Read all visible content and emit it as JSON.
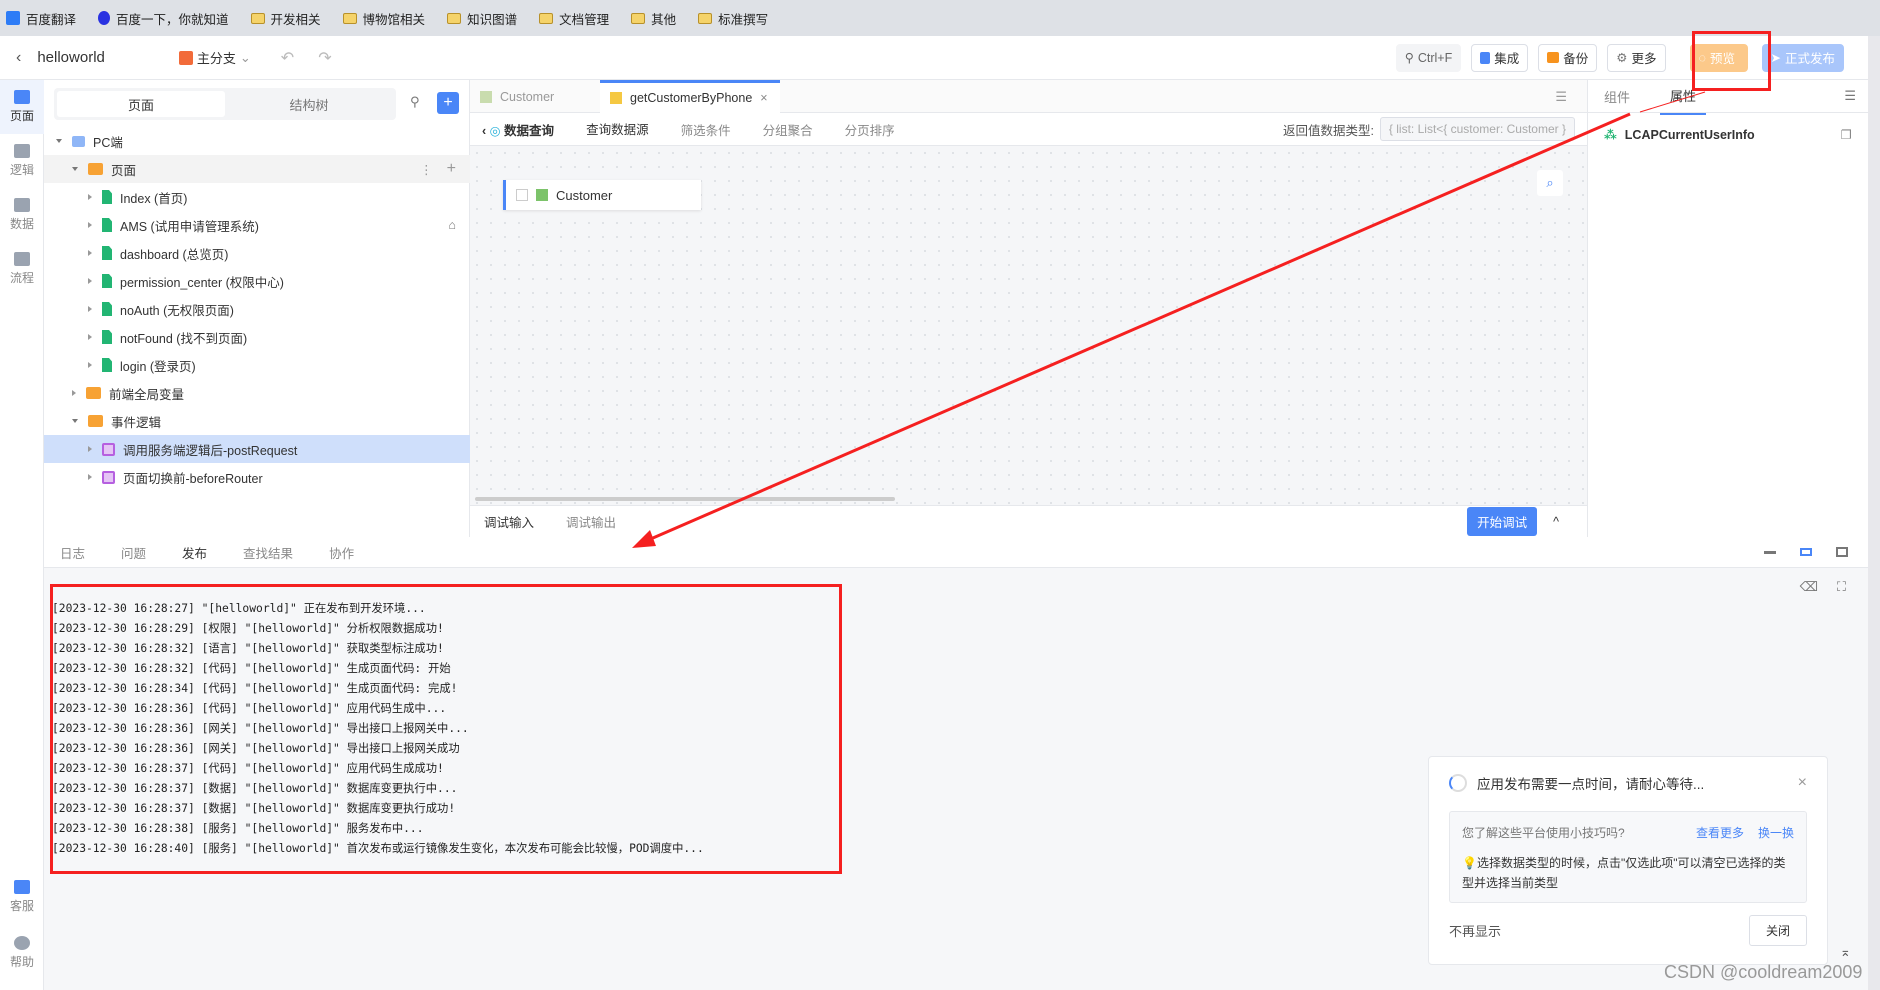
{
  "bookmarks": [
    "百度翻译",
    "百度一下，你就知道",
    "开发相关",
    "博物馆相关",
    "知识图谱",
    "文档管理",
    "其他",
    "标准撰写"
  ],
  "header": {
    "app_name": "helloworld",
    "branch": "主分支",
    "search": "Ctrl+F",
    "integrate": "集成",
    "backup": "备份",
    "more": "更多",
    "preview": "预览",
    "publish": "正式发布"
  },
  "rail": [
    "页面",
    "逻辑",
    "数据",
    "流程",
    "客服",
    "帮助"
  ],
  "left": {
    "tab_page": "页面",
    "tab_tree": "结构树",
    "tree": {
      "root": "PC端",
      "pages_folder": "页面",
      "pages": [
        "Index (首页)",
        "AMS (试用申请管理系统)",
        "dashboard (总览页)",
        "permission_center (权限中心)",
        "noAuth (无权限页面)",
        "notFound (找不到页面)",
        "login (登录页)"
      ],
      "globals": "前端全局变量",
      "events": "事件逻辑",
      "event_items": [
        "调用服务端逻辑后-postRequest",
        "页面切换前-beforeRouter"
      ]
    }
  },
  "center": {
    "tabs": [
      "Customer",
      "getCustomerByPhone"
    ],
    "sub_title": "数据查询",
    "sub_tabs": [
      "查询数据源",
      "筛选条件",
      "分组聚合",
      "分页排序"
    ],
    "return_label": "返回值数据类型:",
    "return_value": "{ list: List<{ customer: Customer }",
    "entity": "Customer",
    "debug_in": "调试输入",
    "debug_out": "调试输出",
    "start_debug": "开始调试"
  },
  "right": {
    "tab_comp": "组件",
    "tab_prop": "属性",
    "item": "LCAPCurrentUserInfo"
  },
  "bottom": {
    "tabs": [
      "日志",
      "问题",
      "发布",
      "查找结果",
      "协作"
    ],
    "active_tab": "发布",
    "logs": [
      "[2023-12-30 16:28:27] \"[helloworld]\" 正在发布到开发环境...",
      "[2023-12-30 16:28:29] [权限] \"[helloworld]\" 分析权限数据成功!",
      "[2023-12-30 16:28:32] [语言] \"[helloworld]\" 获取类型标注成功!",
      "[2023-12-30 16:28:32] [代码] \"[helloworld]\" 生成页面代码: 开始",
      "[2023-12-30 16:28:34] [代码] \"[helloworld]\" 生成页面代码: 完成!",
      "[2023-12-30 16:28:36] [代码] \"[helloworld]\" 应用代码生成中...",
      "[2023-12-30 16:28:36] [网关] \"[helloworld]\" 导出接口上报网关中...",
      "[2023-12-30 16:28:36] [网关] \"[helloworld]\" 导出接口上报网关成功",
      "[2023-12-30 16:28:37] [代码] \"[helloworld]\" 应用代码生成成功!",
      "[2023-12-30 16:28:37] [数据] \"[helloworld]\" 数据库变更执行中...",
      "[2023-12-30 16:28:37] [数据] \"[helloworld]\" 数据库变更执行成功!",
      "[2023-12-30 16:28:38] [服务] \"[helloworld]\" 服务发布中...",
      "[2023-12-30 16:28:40] [服务] \"[helloworld]\" 首次发布或运行镜像发生变化，本次发布可能会比较慢，POD调度中..."
    ]
  },
  "notice": {
    "title": "应用发布需要一点时间，请耐心等待...",
    "tip_q": "您了解这些平台使用小技巧吗?",
    "more": "查看更多",
    "change": "换一换",
    "tip": "选择数据类型的时候，点击\"仅选此项\"可以清空已选择的类型并选择当前类型",
    "no_show": "不再显示",
    "close": "关闭"
  },
  "watermark": "CSDN @cooldream2009",
  "colors": {
    "accent": "#4a86f7",
    "annotation": "#ff2020",
    "preview": "#fcc98a"
  }
}
